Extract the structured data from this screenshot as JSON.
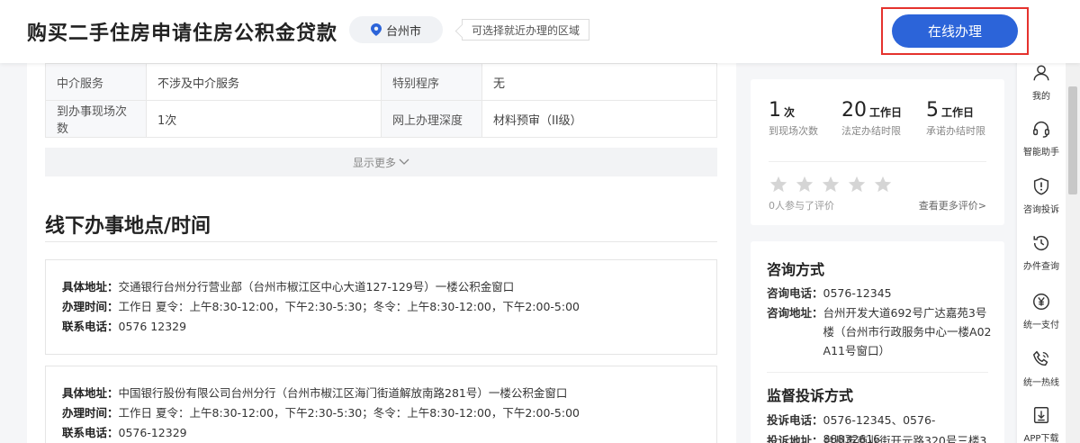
{
  "header": {
    "title": "购买二手住房申请住房公积金贷款",
    "city": "台州市",
    "city_tip": "可选择就近办理的区域",
    "online_button": "在线办理"
  },
  "info_table": [
    [
      "中介服务",
      "不涉及中介服务",
      "特别程序",
      "无"
    ],
    [
      "到办事现场次数",
      "1次",
      "网上办理深度",
      "材料预审（II级）"
    ]
  ],
  "show_more": "显示更多",
  "locations": {
    "title": "线下办事地点/时间",
    "items": [
      {
        "address_label": "具体地址：",
        "address": "交通银行台州分行营业部（台州市椒江区中心大道127-129号）一楼公积金窗口",
        "hours_label": "办理时间：",
        "hours": "工作日 夏令：上午8:30-12:00，下午2:30-5:30；冬令：上午8:30-12:00，下午2:00-5:00",
        "phone_label": "联系电话：",
        "phone": "0576 12329"
      },
      {
        "address_label": "具体地址：",
        "address": "中国银行股份有限公司台州分行（台州市椒江区海门街道解放南路281号）一楼公积金窗口",
        "hours_label": "办理时间：",
        "hours": "工作日 夏令：上午8:30-12:00，下午2:30-5:30；冬令：上午8:30-12:00，下午2:00-5:00",
        "phone_label": "联系电话：",
        "phone": "0576-12329"
      }
    ]
  },
  "stats": [
    {
      "num": "1",
      "unit": "次",
      "caption": "到现场次数"
    },
    {
      "num": "20",
      "unit": "工作日",
      "caption": "法定办结时限"
    },
    {
      "num": "5",
      "unit": "工作日",
      "caption": "承诺办结时限"
    }
  ],
  "rating": {
    "stars": 5,
    "filled": 0,
    "count_text": "0人参与了评价",
    "more_link": "查看更多评价>"
  },
  "contact": {
    "consult_title": "咨询方式",
    "consult_phone_label": "咨询电话：",
    "consult_phone": "0576-12345",
    "consult_addr_label": "咨询地址：",
    "consult_addr": "台州开发大道692号广达嘉苑3号楼（台州市行政服务中心一楼A02 A11号窗口）",
    "complaint_title": "监督投诉方式",
    "complaint_phone_label": "投诉电话：",
    "complaint_phone": "0576-12345、0576-88832616",
    "complaint_addr_label": "投诉地址：",
    "complaint_addr": "台州市商业街开元路320号三楼3"
  },
  "sidebar": [
    {
      "label": "我的",
      "icon": "user-icon"
    },
    {
      "label": "智能助手",
      "icon": "headset-icon"
    },
    {
      "label": "咨询投诉",
      "icon": "shield-icon"
    },
    {
      "label": "办件查询",
      "icon": "history-icon"
    },
    {
      "label": "统一支付",
      "icon": "yuan-icon"
    },
    {
      "label": "统一热线",
      "icon": "phone-icon"
    },
    {
      "label": "APP下载",
      "icon": "download-icon"
    }
  ],
  "colors": {
    "accent": "#2c64d9",
    "highlight_border": "#e5322d",
    "star_empty": "#d5d5d5"
  }
}
